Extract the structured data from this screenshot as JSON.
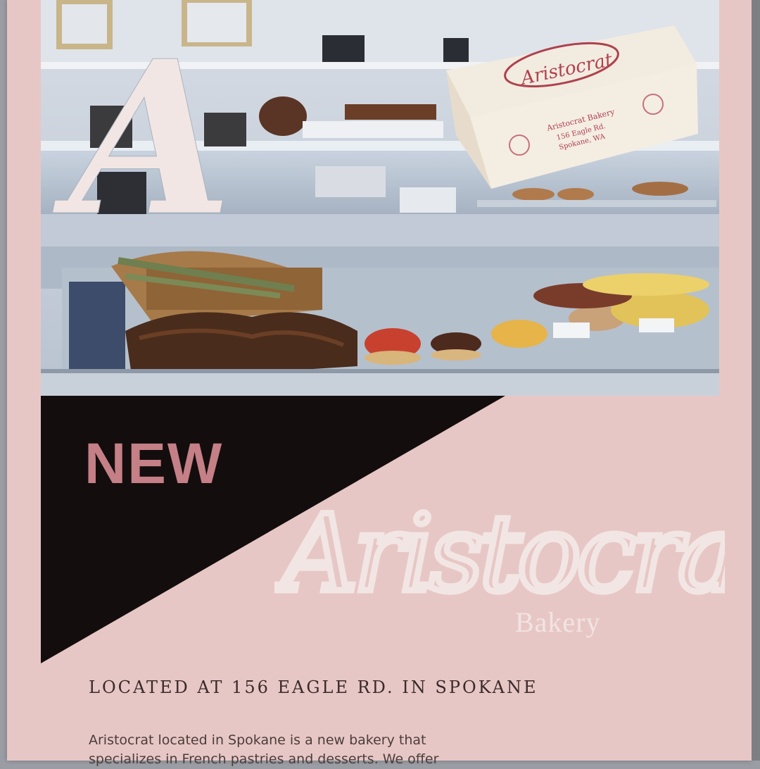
{
  "headline": "NEW",
  "brand": {
    "monogram": "A",
    "script_name": "Aristocrat",
    "subtitle": "Bakery"
  },
  "box_label": {
    "script": "Aristocrat",
    "line1": "Aristocrat Bakery",
    "line2": "156 Eagle Rd.",
    "line3": "Spokane, WA"
  },
  "location": "LOCATED AT 156 EAGLE RD. IN SPOKANE",
  "description": {
    "line1": "Aristocrat located in Spokane is a new bakery that",
    "line2": "specializes in French pastries and desserts. We offer"
  },
  "colors": {
    "page_bg": "#e7c7c5",
    "accent_pink": "#c48086",
    "black_panel": "#140d0e",
    "script_white": "#f2e6e4"
  }
}
